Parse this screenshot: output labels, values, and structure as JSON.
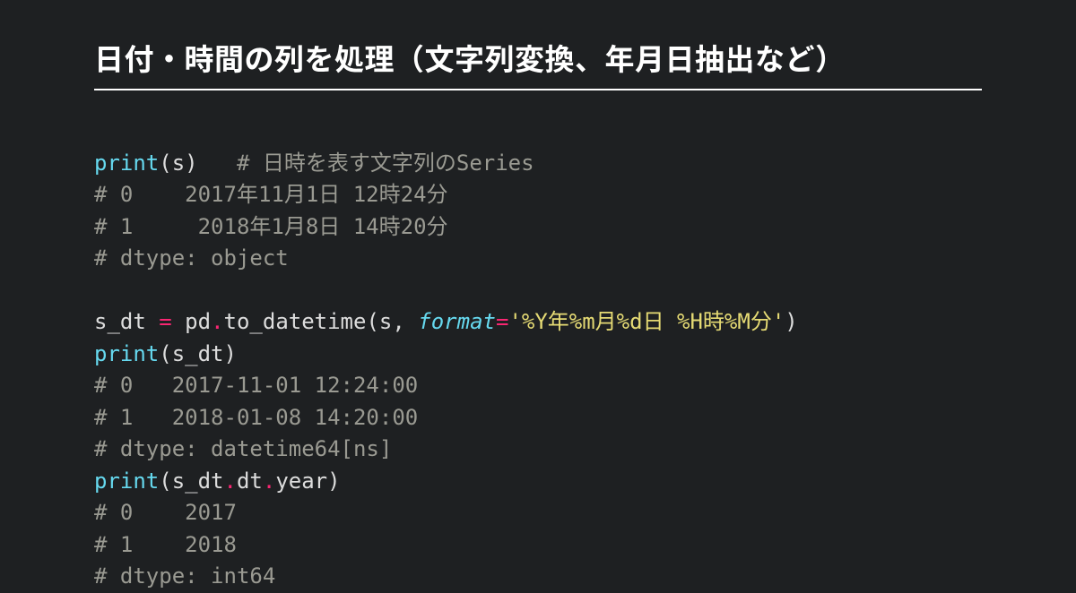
{
  "title": "日付・時間の列を処理（文字列変換、年月日抽出など）",
  "code": {
    "l1_fn": "print",
    "l1_open": "(",
    "l1_arg": "s",
    "l1_close": ")",
    "l1_sp": "   ",
    "l1_comment": "# 日時を表す文字列のSeries",
    "l2": "# 0    2017年11月1日 12時24分",
    "l3": "# 1     2018年1月8日 14時20分",
    "l4": "# dtype: object",
    "blank": " ",
    "l5_lhs": "s_dt ",
    "l5_eq": "=",
    "l5_sp1": " pd",
    "l5_dot1": ".",
    "l5_m": "to_datetime",
    "l5_open": "(",
    "l5_a1": "s, ",
    "l5_kw": "format",
    "l5_eq2": "=",
    "l5_str": "'%Y年%m月%d日 %H時%M分'",
    "l5_close": ")",
    "l6_fn": "print",
    "l6_open": "(",
    "l6_arg": "s_dt",
    "l6_close": ")",
    "l7": "# 0   2017-11-01 12:24:00",
    "l8": "# 1   2018-01-08 14:20:00",
    "l9": "# dtype: datetime64[ns]",
    "l10_fn": "print",
    "l10_open": "(",
    "l10_a1": "s_dt",
    "l10_dot1": ".",
    "l10_a2": "dt",
    "l10_dot2": ".",
    "l10_a3": "year",
    "l10_close": ")",
    "l11": "# 0    2017",
    "l12": "# 1    2018",
    "l13": "# dtype: int64"
  }
}
